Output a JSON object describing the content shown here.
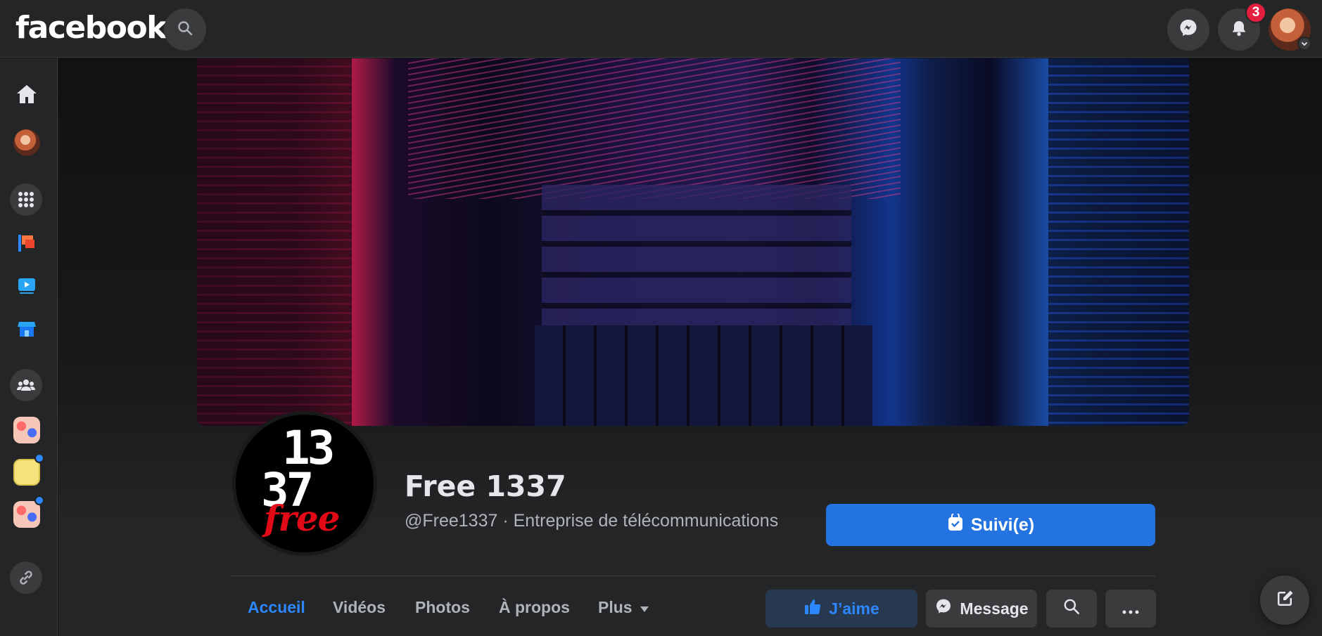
{
  "header": {
    "logo": "facebook",
    "notification_count": "3"
  },
  "page": {
    "name": "Free 1337",
    "subtitle": "@Free1337 · Entreprise de télécommunications",
    "profile_logo_digits_top": "13",
    "profile_logo_digits_bottom": "37",
    "profile_logo_word": "free",
    "follow_button": "Suivi(e)"
  },
  "tabs": [
    {
      "label": "Accueil"
    },
    {
      "label": "Vidéos"
    },
    {
      "label": "Photos"
    },
    {
      "label": "À propos"
    },
    {
      "label": "Plus"
    }
  ],
  "actions": {
    "like": "J’aime",
    "message": "Message"
  },
  "left_rail": {
    "icons": [
      "home-icon",
      "profile-avatar",
      "menu-grid-icon",
      "pages-flag-icon",
      "watch-video-icon",
      "marketplace-store-icon",
      "groups-icon",
      "group-avatar-1",
      "group-avatar-2",
      "group-avatar-3",
      "link-icon"
    ]
  },
  "colors": {
    "accent": "#2374e1",
    "link_blue": "#2d88ff",
    "badge_red": "#e41e3f",
    "surface": "#242526",
    "background": "#18191a"
  }
}
